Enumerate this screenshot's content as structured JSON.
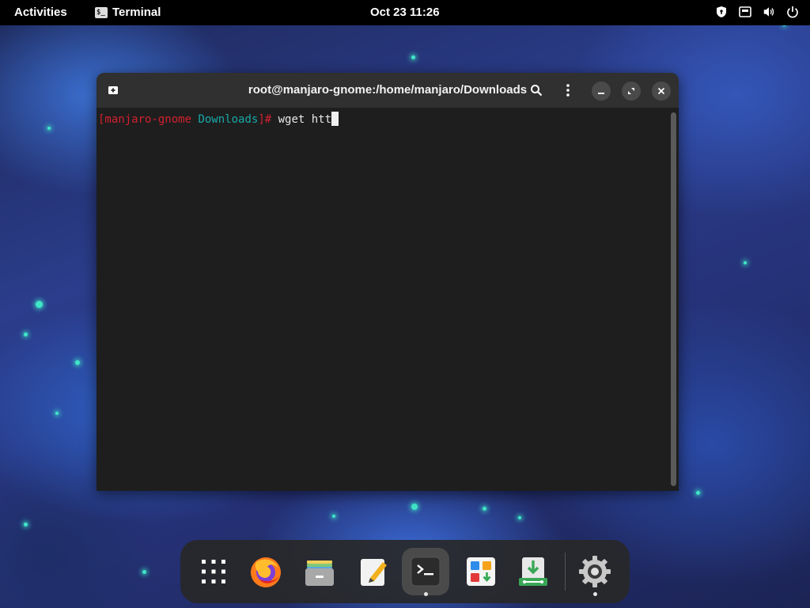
{
  "topbar": {
    "activities": "Activities",
    "app_name": "Terminal",
    "app_icon_glyph": "$_",
    "clock": "Oct 23  11:26",
    "tray_icons": [
      "shield-icon",
      "network-icon",
      "volume-icon",
      "power-icon"
    ]
  },
  "window": {
    "title": "root@manjaro-gnome:/home/manjaro/Downloads",
    "buttons": [
      "new-tab-icon",
      "search-icon",
      "menu-icon",
      "minimize-icon",
      "maximize-icon",
      "close-icon"
    ]
  },
  "terminal": {
    "prompt_host": "[manjaro-gnome",
    "prompt_dir": "Downloads",
    "prompt_end": "]#",
    "command": "wget htt"
  },
  "dock": {
    "items": [
      "app-grid-icon",
      "firefox-icon",
      "files-icon",
      "text-editor-icon",
      "terminal-icon",
      "software-icon",
      "downloader-icon",
      "settings-icon"
    ]
  },
  "colors": {
    "prompt_red": "#d2202f",
    "prompt_cyan": "#19a8a8",
    "terminal_bg": "#1e1e1e",
    "headerbar_bg": "#303030"
  }
}
